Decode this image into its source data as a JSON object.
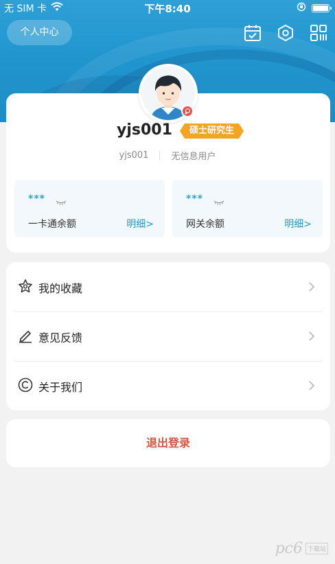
{
  "status_bar": {
    "carrier": "无 SIM 卡",
    "time": "下午8:40",
    "icons": [
      "wifi-icon",
      "orientation-lock-icon",
      "battery-icon"
    ]
  },
  "nav": {
    "title": "个人中心",
    "icons": [
      "calendar-icon",
      "settings-icon",
      "qrcode-icon"
    ]
  },
  "profile": {
    "username": "yjs001",
    "role": "硕士研究生",
    "account_id": "yjs001",
    "info_status": "无信息用户",
    "balances": [
      {
        "masked_value": "***",
        "label": "一卡通余额",
        "detail": "明细>"
      },
      {
        "masked_value": "***",
        "label": "网关余额",
        "detail": "明细>"
      }
    ]
  },
  "menu": {
    "items": [
      {
        "label": "我的收藏",
        "icon": "favorite-star-icon"
      },
      {
        "label": "意见反馈",
        "icon": "edit-pen-icon"
      },
      {
        "label": "关于我们",
        "icon": "copyright-icon"
      }
    ]
  },
  "logout": {
    "label": "退出登录"
  },
  "watermark": {
    "text": "pc6",
    "sub": "下载站"
  },
  "colors": {
    "header_blue": "#2196cf",
    "tag_orange": "#f3a423",
    "link_teal": "#1f9bc3",
    "logout_red": "#d9533f",
    "page_bg": "#f2f2f2"
  }
}
